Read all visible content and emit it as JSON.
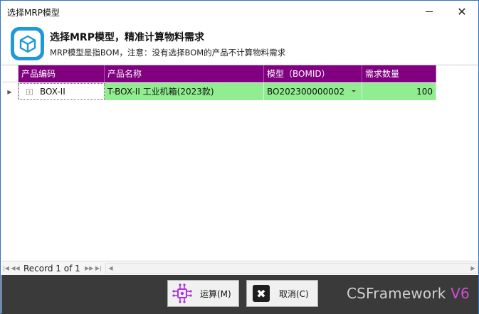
{
  "window": {
    "title": "选择MRP模型",
    "close_glyph": "✕"
  },
  "header": {
    "heading": "选择MRP模型，精准计算物料需求",
    "subheading": "MRP模型是指BOM，注意：没有选择BOM的产品不计算物料需求",
    "logo_icon": "box-cube-icon",
    "accent": "#1f9ad6"
  },
  "grid": {
    "header_color": "#800080",
    "columns": [
      "产品编码",
      "产品名称",
      "模型（BOMID）",
      "需求数量"
    ],
    "rows": [
      {
        "product_code": "BOX-II",
        "product_name": "T-BOX-II 工业机箱(2023款)",
        "bom_id": "BO202300000002",
        "quantity": "100"
      }
    ],
    "row_highlight": "#90ee90"
  },
  "navigator": {
    "record_text": "Record 1 of 1"
  },
  "footer": {
    "calc_label": "运算(M)",
    "cancel_label": "取消(C)",
    "cancel_glyph": "✖",
    "brand_name": "CSFramework",
    "brand_version": "V6",
    "background": "#3a3a3a"
  }
}
